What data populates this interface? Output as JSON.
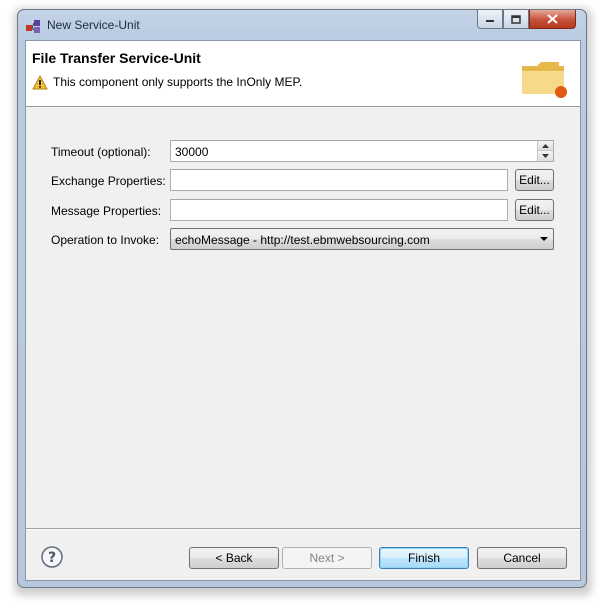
{
  "window": {
    "title": "New Service-Unit",
    "controls": {
      "minimize_icon": "minimize-icon",
      "maximize_icon": "maximize-icon",
      "close_icon": "close-icon"
    }
  },
  "header": {
    "title": "File Transfer Service-Unit",
    "message": "This component only supports the InOnly MEP.",
    "message_icon": "warning-icon",
    "banner_icon": "folder-icon"
  },
  "form": {
    "timeout": {
      "label": "Timeout (optional):",
      "value": "30000"
    },
    "exchange": {
      "label": "Exchange Properties:",
      "value": "",
      "button": "Edit..."
    },
    "message": {
      "label": "Message Properties:",
      "value": "",
      "button": "Edit..."
    },
    "operation": {
      "label": "Operation to Invoke:",
      "value": "echoMessage - http://test.ebmwebsourcing.com"
    }
  },
  "footer": {
    "help_icon": "help-icon",
    "back": "< Back",
    "next": "Next >",
    "finish": "Finish",
    "cancel": "Cancel"
  },
  "colors": {
    "accent": "#3c7fb1",
    "warning": "#f2c13a",
    "close": "#c7503b"
  }
}
